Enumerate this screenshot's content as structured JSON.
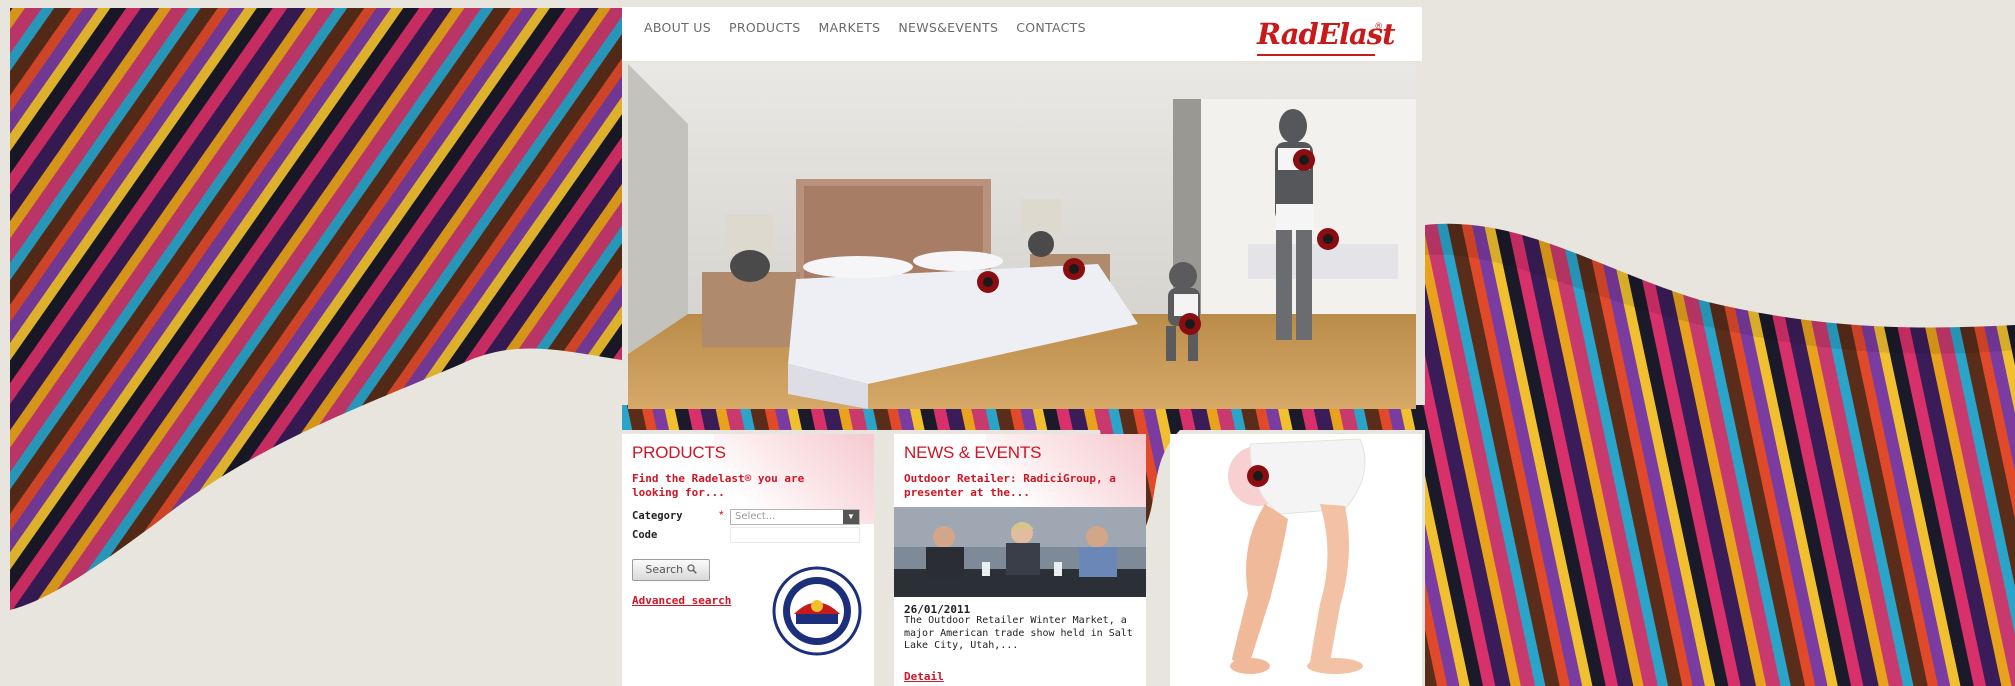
{
  "nav": {
    "items": [
      "ABOUT US",
      "PRODUCTS",
      "MARKETS",
      "NEWS&EVENTS",
      "CONTACTS"
    ]
  },
  "brand": {
    "logo_text": "RadElast",
    "logo_mark": "®"
  },
  "colors": {
    "accent": "#d01524",
    "page_bg": "#e7e5de"
  },
  "products": {
    "title": "PRODUCTS",
    "subtitle": "Find the Radelast® you are looking for...",
    "category_label": "Category",
    "required_mark": "*",
    "category_value": "Select...",
    "code_label": "Code",
    "code_value": "",
    "search_label": "Search",
    "advanced_link": "Advanced search"
  },
  "news": {
    "title": "NEWS & EVENTS",
    "headline": "Outdoor Retailer: RadiciGroup, a presenter at the...",
    "date": "26/01/2011",
    "body": "The Outdoor Retailer Winter Market, a major American trade show held in Salt Lake City, Utah,...",
    "detail_link": "Detail"
  },
  "icons": {
    "select_arrow": "chevron-down-icon",
    "search": "search-icon",
    "hotspot": "hotspot-icon",
    "badge": "certification-badge-icon"
  }
}
